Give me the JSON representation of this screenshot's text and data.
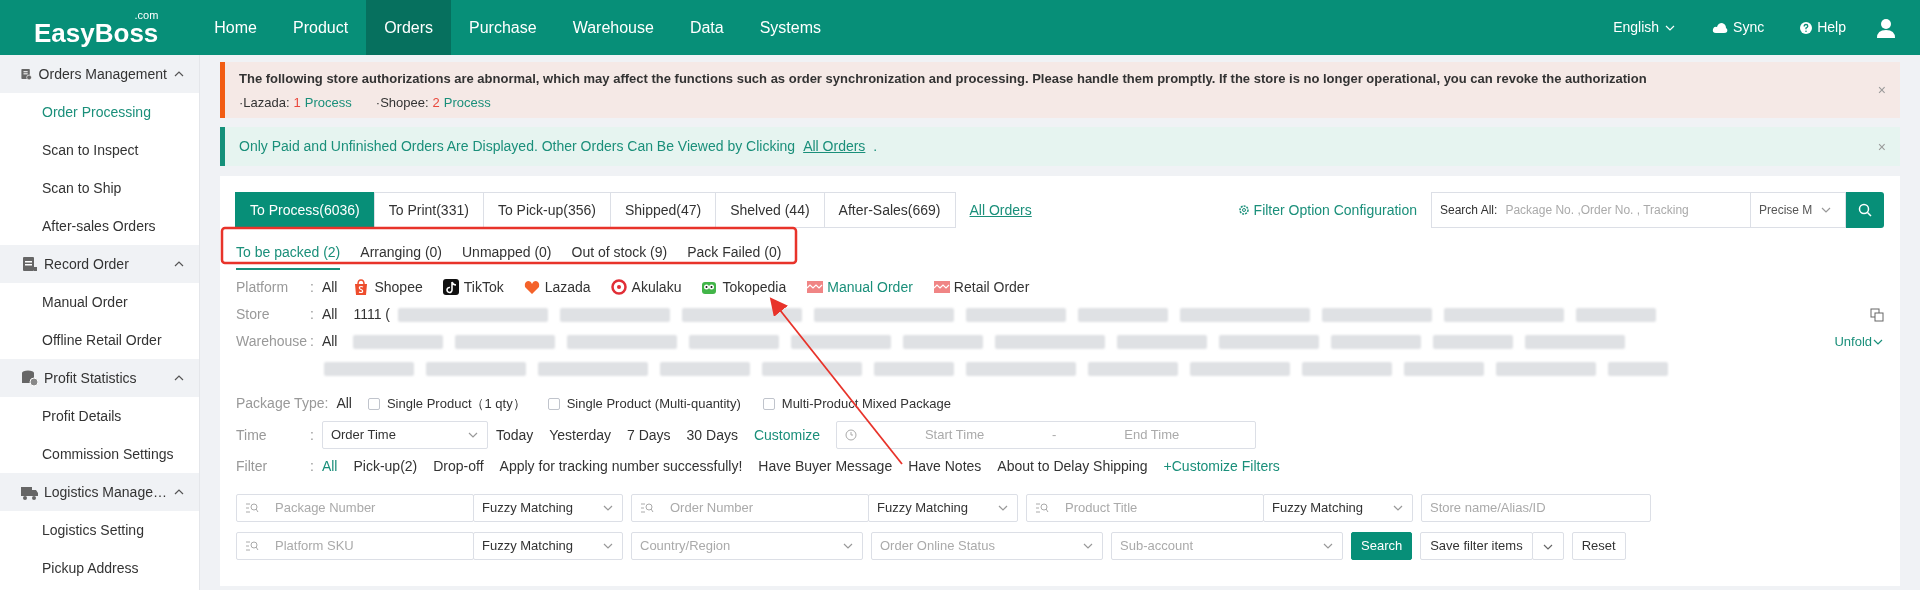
{
  "brand": {
    "name": "EasyBoss",
    "suffix": ".com"
  },
  "nav": [
    {
      "label": "Home",
      "selected": false
    },
    {
      "label": "Product",
      "selected": false
    },
    {
      "label": "Orders",
      "selected": true
    },
    {
      "label": "Purchase",
      "selected": false
    },
    {
      "label": "Warehouse",
      "selected": false
    },
    {
      "label": "Data",
      "selected": false
    },
    {
      "label": "Systems",
      "selected": false
    }
  ],
  "topbar_right": {
    "language": "English",
    "sync": "Sync",
    "help": "Help"
  },
  "sidebar": [
    {
      "label": "Orders Management",
      "kind": "clipboard",
      "expanded": true,
      "children": [
        {
          "label": "Order Processing",
          "selected": true
        },
        {
          "label": "Scan to Inspect",
          "selected": false
        },
        {
          "label": "Scan to Ship",
          "selected": false
        },
        {
          "label": "After-sales Orders",
          "selected": false
        }
      ]
    },
    {
      "label": "Record Order",
      "kind": "document",
      "expanded": true,
      "children": [
        {
          "label": "Manual Order",
          "selected": false
        },
        {
          "label": "Offline Retail Order",
          "selected": false
        }
      ]
    },
    {
      "label": "Profit Statistics",
      "kind": "coins",
      "expanded": true,
      "children": [
        {
          "label": "Profit Details",
          "selected": false
        },
        {
          "label": "Commission Settings",
          "selected": false
        }
      ]
    },
    {
      "label": "Logistics Manage…",
      "kind": "truck",
      "expanded": true,
      "children": [
        {
          "label": "Logistics Setting",
          "selected": false
        },
        {
          "label": "Pickup Address",
          "selected": false
        }
      ]
    }
  ],
  "alerts": [
    {
      "kind": "warning",
      "text": "The following store authorizations are abnormal, which may affect the functions such as order synchronization and processing. Please handle them promptly. If the store is no longer operational, you can revoke the authorization",
      "stores": [
        {
          "platform": "·Lazada:",
          "count": "1",
          "action": "Process"
        },
        {
          "platform": "·Shopee:",
          "count": "2",
          "action": "Process"
        }
      ],
      "close": "×"
    },
    {
      "kind": "info",
      "text": "Only Paid and Unfinished Orders Are Displayed. Other Orders Can Be Viewed by Clicking",
      "link": "All Orders",
      "tail": ".",
      "close": "×"
    }
  ],
  "status_tabs": [
    {
      "label": "To Process(6036)",
      "selected": true
    },
    {
      "label": "To Print(331)",
      "selected": false
    },
    {
      "label": "To Pick-up(356)",
      "selected": false
    },
    {
      "label": "Shipped(47)",
      "selected": false
    },
    {
      "label": "Shelved (44)",
      "selected": false
    },
    {
      "label": "After-Sales(669)",
      "selected": false
    }
  ],
  "all_orders_link": "All Orders",
  "filter_config": "Filter Option Configuration",
  "search": {
    "label": "Search All:",
    "placeholder": "Package No. ,Order No. , Tracking",
    "mode": "Precise M"
  },
  "sub_tabs": [
    {
      "label": "To be packed (2)",
      "selected": true
    },
    {
      "label": "Arranging (0)",
      "selected": false
    },
    {
      "label": "Unmapped (0)",
      "selected": false
    },
    {
      "label": "Out of stock (9)",
      "selected": false
    },
    {
      "label": "Pack Failed (0)",
      "selected": false
    }
  ],
  "platform": {
    "label": "Platform",
    "colon": ":",
    "all": "All",
    "items": [
      {
        "label": "Shopee",
        "kind": "shopee",
        "selected": false
      },
      {
        "label": "TikTok",
        "kind": "tiktok",
        "selected": false
      },
      {
        "label": "Lazada",
        "kind": "lazada",
        "selected": false
      },
      {
        "label": "Akulaku",
        "kind": "akulaku",
        "selected": false
      },
      {
        "label": "Tokopedia",
        "kind": "tokopedia",
        "selected": false
      },
      {
        "label": "Manual Order",
        "kind": "manual",
        "selected": true
      },
      {
        "label": "Retail Order",
        "kind": "retail",
        "selected": false
      }
    ]
  },
  "store": {
    "label": "Store",
    "colon": ":",
    "all": "All",
    "first": "1111 ("
  },
  "warehouse": {
    "label": "Warehouse",
    "colon": ":",
    "all": "All",
    "unfold": "Unfold"
  },
  "package_type": {
    "label": "Package Type",
    "colon": ":",
    "all": "All",
    "options": [
      {
        "label": "Single Product（1 qty）",
        "checked": false
      },
      {
        "label": "Single Product (Multi-quantity)",
        "checked": false
      },
      {
        "label": "Multi-Product Mixed Package",
        "checked": false
      }
    ]
  },
  "time": {
    "label": "Time",
    "colon": ":",
    "select": "Order Time",
    "quick": [
      "Today",
      "Yesterday",
      "7 Days",
      "30 Days"
    ],
    "customize": "Customize",
    "start_placeholder": "Start Time",
    "separator": "-",
    "end_placeholder": "End Time"
  },
  "filter": {
    "label": "Filter",
    "colon": ":",
    "all": "All",
    "items": [
      "Pick-up(2)",
      "Drop-off",
      "Apply for tracking number successfully!",
      "Have Buyer Message",
      "Have Notes",
      "About to Delay Shipping"
    ],
    "customize": "+Customize Filters"
  },
  "search_rows": [
    [
      {
        "kind": "match",
        "placeholder": "Package Number",
        "match": "Fuzzy Matching"
      },
      {
        "kind": "match",
        "placeholder": "Order Number",
        "match": "Fuzzy Matching"
      },
      {
        "kind": "match",
        "placeholder": "Product Title",
        "match": "Fuzzy Matching"
      },
      {
        "kind": "text",
        "placeholder": "Store name/Alias/ID"
      }
    ],
    [
      {
        "kind": "match",
        "placeholder": "Platform SKU",
        "match": "Fuzzy Matching"
      },
      {
        "kind": "select",
        "placeholder": "Country/Region"
      },
      {
        "kind": "select",
        "placeholder": "Order Online Status"
      },
      {
        "kind": "select",
        "placeholder": "Sub-account"
      },
      {
        "kind": "primary",
        "label": "Search"
      },
      {
        "kind": "split",
        "label": "Save filter items"
      },
      {
        "kind": "button",
        "label": "Reset"
      }
    ]
  ]
}
